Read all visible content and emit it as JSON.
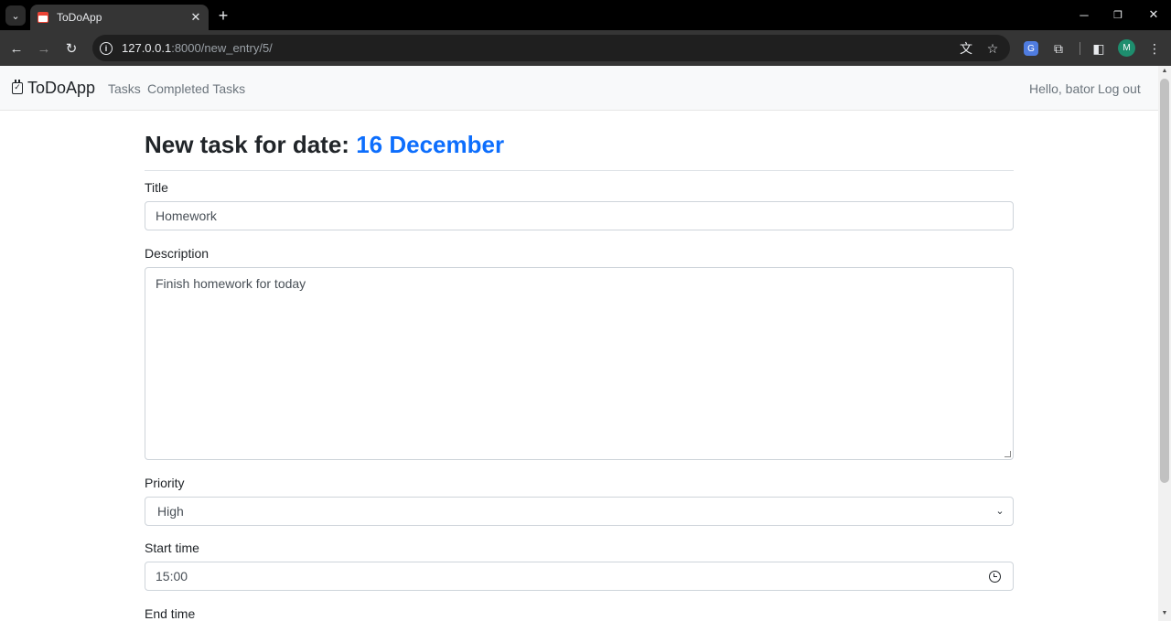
{
  "browser": {
    "tab_title": "ToDoApp",
    "tab_close": "✕",
    "new_tab": "+",
    "url_host": "127.0.0.1",
    "url_rest": ":8000/new_entry/5/",
    "profile_initial": "M",
    "window_controls": {
      "minimize": "─",
      "maximize": "❐",
      "close": "✕"
    }
  },
  "navbar": {
    "brand": "ToDoApp",
    "links": [
      "Tasks",
      "Completed Tasks"
    ],
    "greeting": "Hello, bator",
    "logout": "Log out"
  },
  "form": {
    "heading_prefix": "New task for date:",
    "heading_date": "16 December",
    "accent_color": "#0d6efd",
    "title_label": "Title",
    "title_value": "Homework",
    "description_label": "Description",
    "description_value": "Finish homework for today",
    "priority_label": "Priority",
    "priority_value": "High",
    "start_time_label": "Start time",
    "start_time_value": "15:00",
    "end_time_label": "End time"
  }
}
